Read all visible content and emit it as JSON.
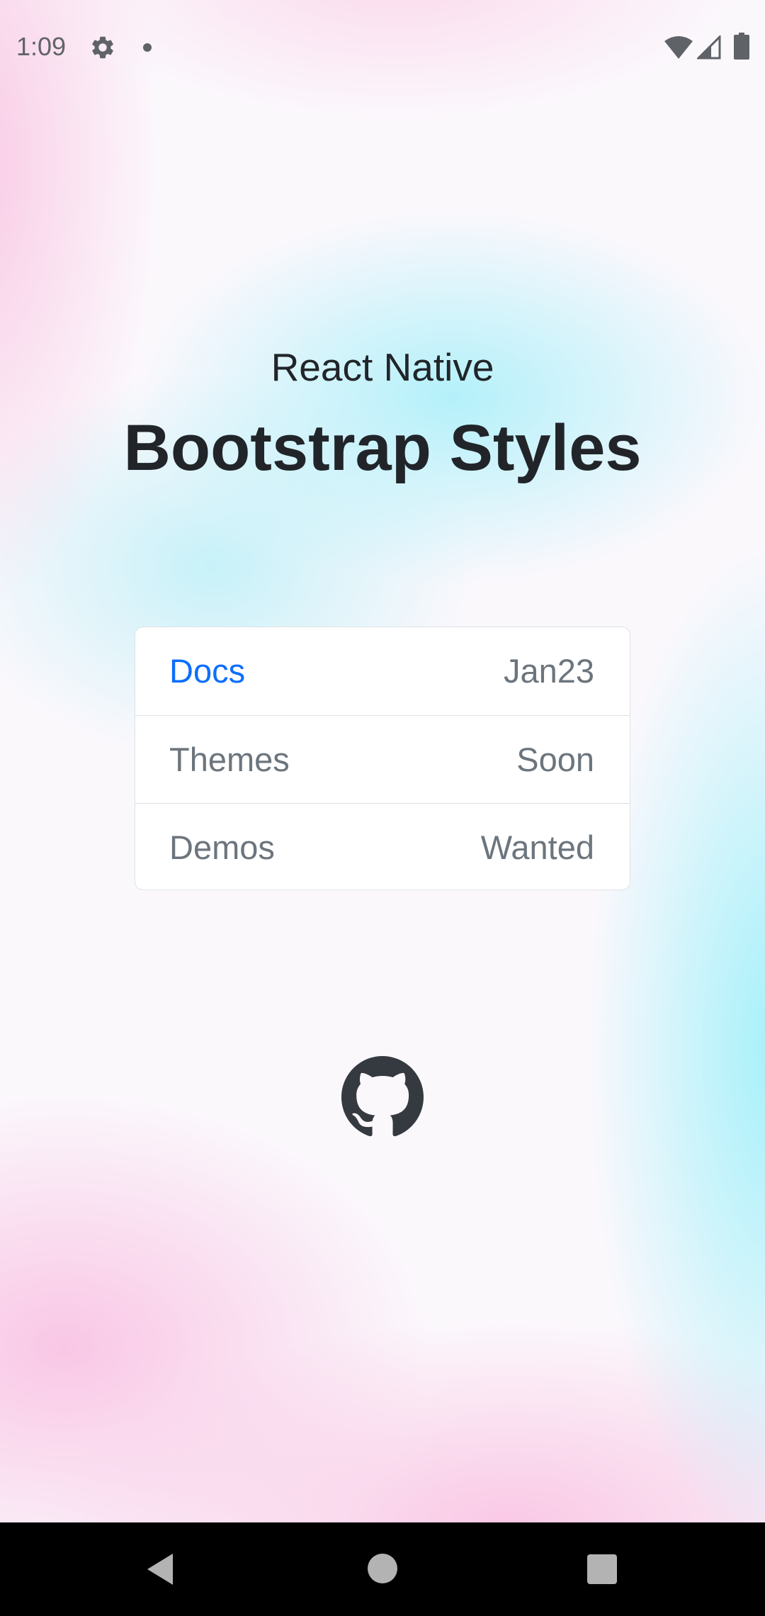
{
  "status_bar": {
    "time": "1:09"
  },
  "header": {
    "subtitle": "React Native",
    "title": "Bootstrap Styles"
  },
  "list": {
    "items": [
      {
        "label": "Docs",
        "value": "Jan23",
        "active": true
      },
      {
        "label": "Themes",
        "value": "Soon",
        "active": false
      },
      {
        "label": "Demos",
        "value": "Wanted",
        "active": false
      }
    ]
  },
  "colors": {
    "text": "#212529",
    "muted": "#6c757d",
    "primary": "#0d6efd",
    "border": "#dee2e6"
  },
  "icons": {
    "status": [
      "gear-icon",
      "notification-dot-icon",
      "wifi-icon",
      "signal-icon",
      "battery-icon"
    ],
    "footer": "github-icon",
    "nav": [
      "back-icon",
      "home-icon",
      "recents-icon"
    ]
  }
}
